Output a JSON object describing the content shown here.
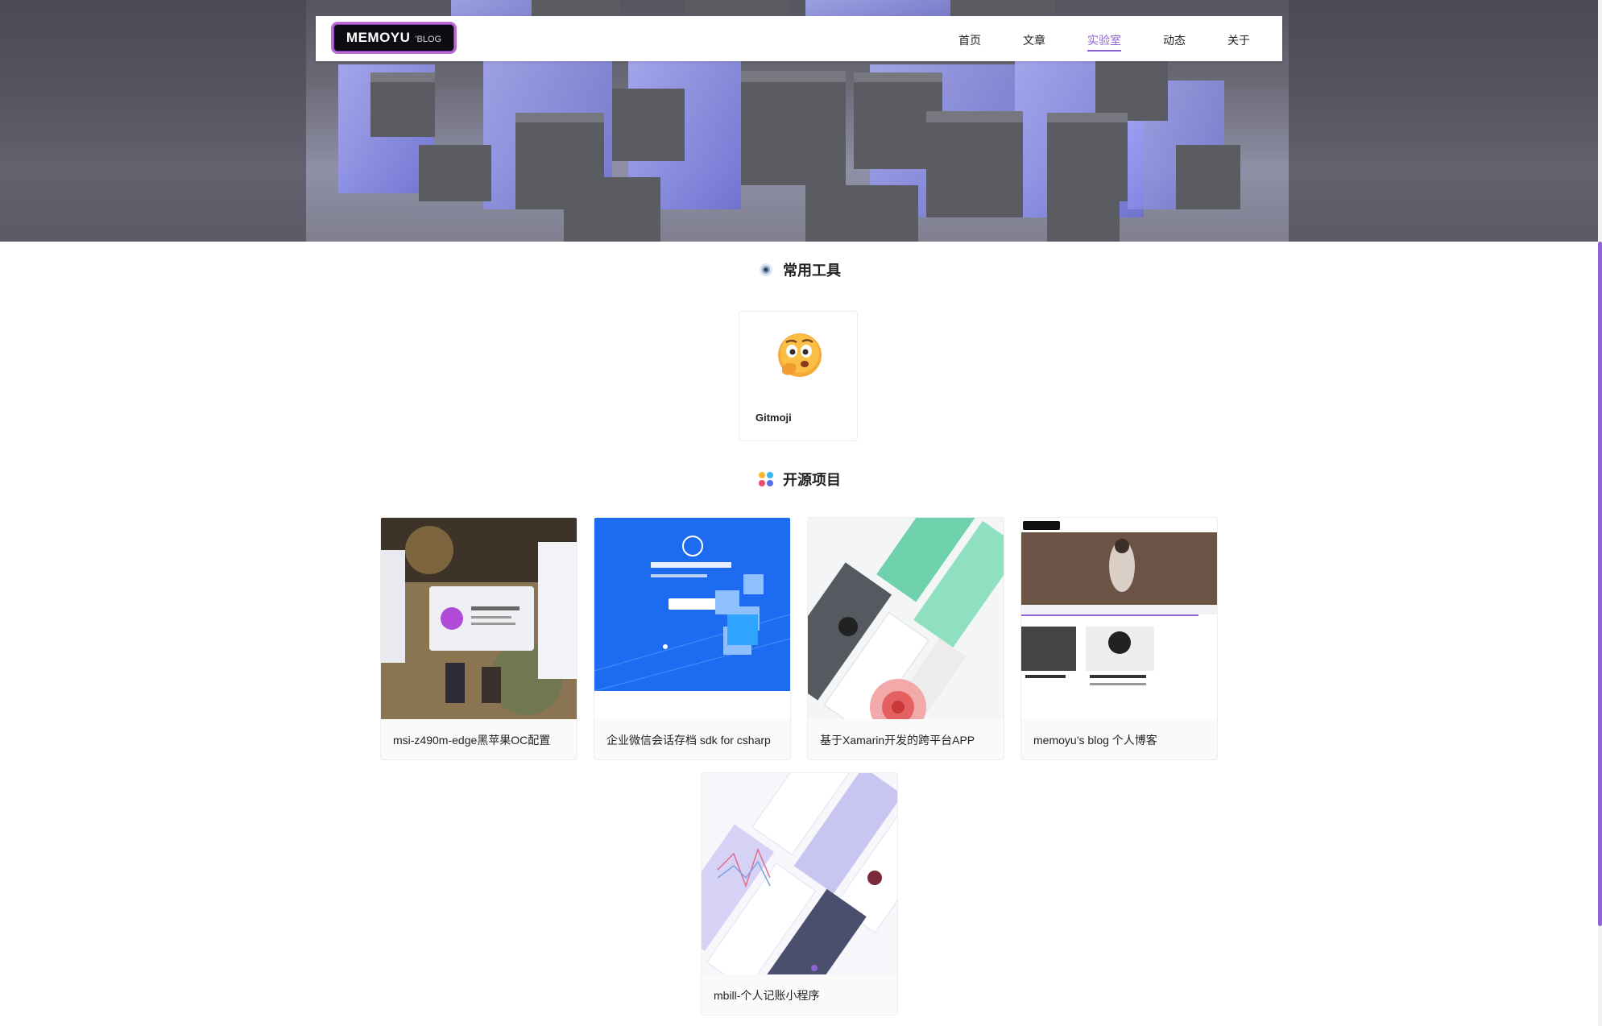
{
  "nav": {
    "logo_main": "MEMOYU",
    "logo_sub": "'BLOG",
    "items": [
      {
        "label": "首页"
      },
      {
        "label": "文章"
      },
      {
        "label": "实验室",
        "active": true
      },
      {
        "label": "动态"
      },
      {
        "label": "关于"
      }
    ]
  },
  "tools_section": {
    "title": "常用工具",
    "tools": [
      {
        "name": "Gitmoji"
      }
    ]
  },
  "projects_section": {
    "title": "开源项目",
    "projects": [
      {
        "name": "msi-z490m-edge黑苹果OC配置"
      },
      {
        "name": "企业微信会话存档 sdk for csharp"
      },
      {
        "name": "基于Xamarin开发的跨平台APP"
      },
      {
        "name": "memoyu’s blog 个人博客"
      },
      {
        "name": "mbill-个人记账小程序"
      }
    ]
  },
  "colors": {
    "accent": "#8e63d6",
    "hero_blue": "#7b7fe6"
  }
}
